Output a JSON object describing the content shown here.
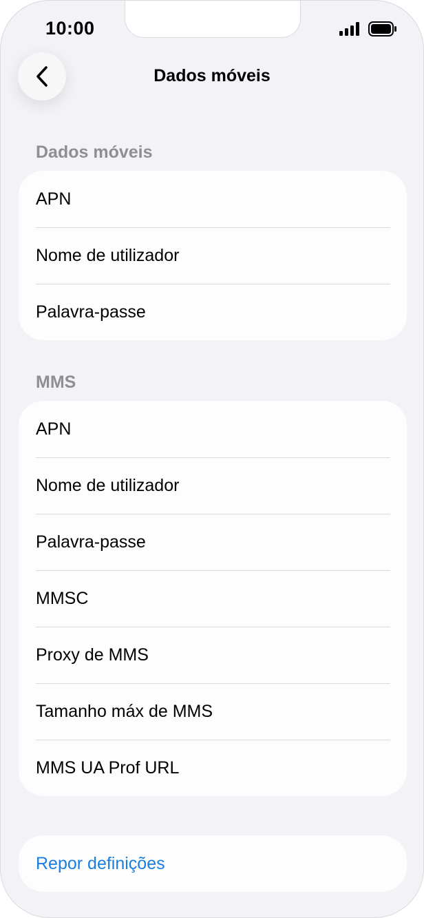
{
  "status_bar": {
    "time": "10:00",
    "signal_icon": "cellular-signal-icon",
    "battery_icon": "battery-icon"
  },
  "nav": {
    "back_icon": "chevron-left-icon",
    "title": "Dados móveis"
  },
  "sections": {
    "mobile_data": {
      "header": "Dados móveis",
      "items": [
        "APN",
        "Nome de utilizador",
        "Palavra-passe"
      ]
    },
    "mms": {
      "header": "MMS",
      "items": [
        "APN",
        "Nome de utilizador",
        "Palavra-passe",
        "MMSC",
        "Proxy de MMS",
        "Tamanho máx de MMS",
        "MMS UA Prof URL"
      ]
    }
  },
  "reset": {
    "label": "Repor definições"
  },
  "colors": {
    "background": "#f2f2f7",
    "card": "#fdfdfd",
    "link": "#1a7ee0",
    "secondary_text": "#8e8e93"
  }
}
